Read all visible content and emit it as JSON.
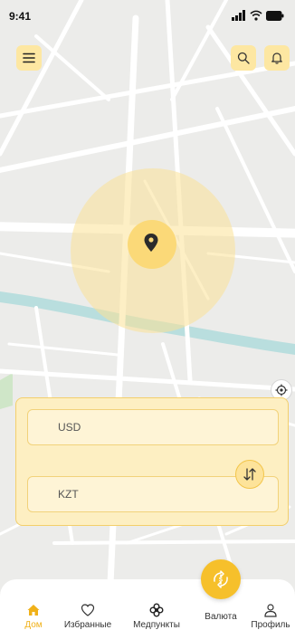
{
  "status": {
    "time": "9:41"
  },
  "converter": {
    "from_currency": "USD",
    "to_currency": "KZT"
  },
  "tabs": [
    {
      "label": "Дом",
      "icon": "home-icon",
      "active": true
    },
    {
      "label": "Избранные",
      "icon": "heart-icon"
    },
    {
      "label": "Медпункты",
      "icon": "flower-icon"
    },
    {
      "label": "Валюта",
      "icon": "currency-exchange-icon"
    },
    {
      "label": "Профиль",
      "icon": "user-icon"
    }
  ],
  "colors": {
    "accent": "#f6c02b",
    "accent_light": "#fde7a2",
    "map_bg": "#ececea",
    "water": "#b9dede",
    "park": "#cfe6c8"
  }
}
